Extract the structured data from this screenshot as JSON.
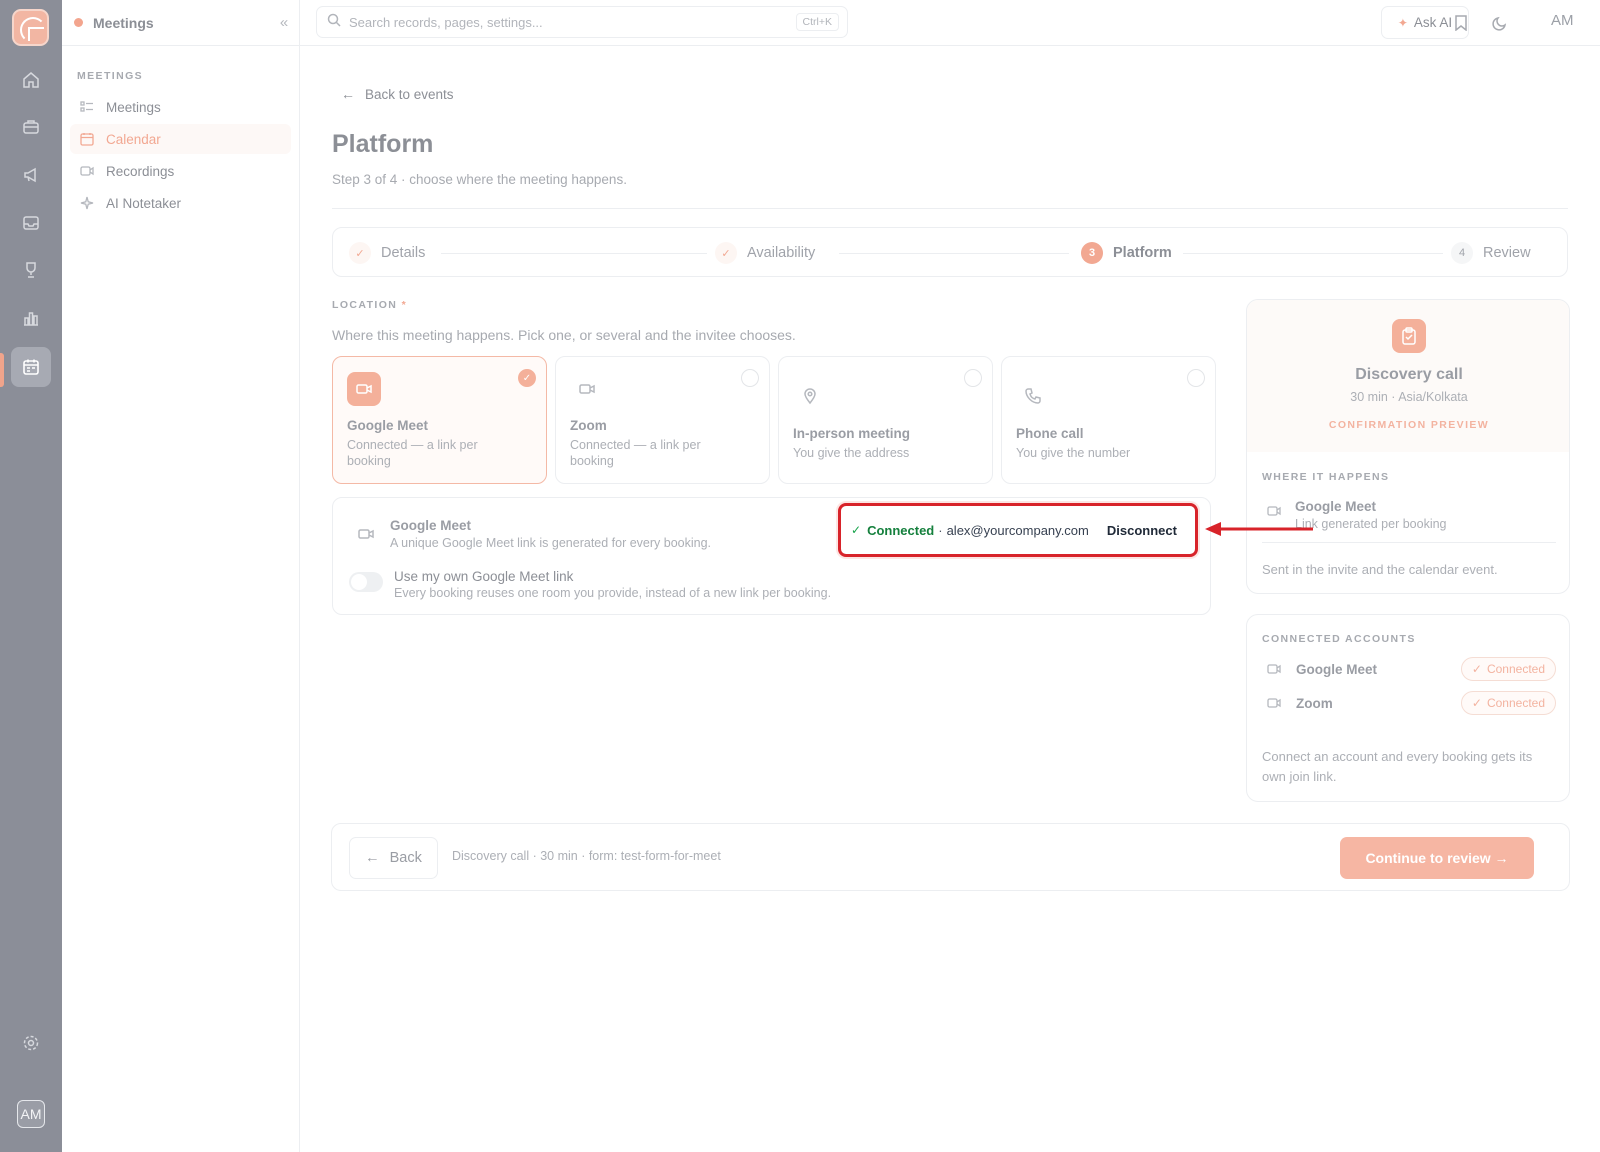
{
  "app": {
    "section_title": "Meetings",
    "collapse_glyph": "«"
  },
  "rail": {
    "icons": [
      "home-icon",
      "briefcase-icon",
      "megaphone-icon",
      "inbox-icon",
      "trophy-icon",
      "bar-chart-icon",
      "calendar-icon"
    ],
    "avatar_initials": "AM"
  },
  "sidebar": {
    "section_label": "MEETINGS",
    "items": [
      {
        "label": "Meetings",
        "icon": "list-icon"
      },
      {
        "label": "Calendar",
        "icon": "calendar-icon",
        "active": true
      },
      {
        "label": "Recordings",
        "icon": "video-icon"
      },
      {
        "label": "AI Notetaker",
        "icon": "sparkle-icon"
      }
    ]
  },
  "topbar": {
    "search_placeholder": "Search records, pages, settings...",
    "search_shortcut": "Ctrl+K",
    "ask_ai_label": "Ask AI",
    "initials": "AM"
  },
  "page": {
    "back_label": "Back to events",
    "title": "Platform",
    "subtitle": "Step 3 of 4 · choose where the meeting happens."
  },
  "stepper": [
    {
      "label": "Details",
      "status": "done",
      "badge": "✓"
    },
    {
      "label": "Availability",
      "status": "done",
      "badge": "✓"
    },
    {
      "label": "Platform",
      "status": "current",
      "badge": "3"
    },
    {
      "label": "Review",
      "status": "todo",
      "badge": "4"
    }
  ],
  "location": {
    "label": "LOCATION",
    "required_mark": "*",
    "help": "Where this meeting happens. Pick one, or several and the invitee chooses.",
    "options": [
      {
        "name": "Google Meet",
        "desc": "Connected — a link per booking",
        "icon": "video-icon",
        "selected": true
      },
      {
        "name": "Zoom",
        "desc": "Connected — a link per booking",
        "icon": "video-icon",
        "selected": false
      },
      {
        "name": "In-person meeting",
        "desc": "You give the address",
        "icon": "map-pin-icon",
        "selected": false
      },
      {
        "name": "Phone call",
        "desc": "You give the number",
        "icon": "phone-icon",
        "selected": false
      }
    ]
  },
  "detail": {
    "name": "Google Meet",
    "desc": "A unique Google Meet link is generated for every booking.",
    "toggle_label": "Use my own Google Meet link",
    "toggle_desc": "Every booking reuses one room you provide, instead of a new link per booking.",
    "toggle_on": false,
    "connection": {
      "status": "Connected",
      "separator": "·",
      "email": "alex@yourcompany.com",
      "disconnect_label": "Disconnect"
    }
  },
  "summary": {
    "title": "Discovery call",
    "meta": "30 min · Asia/Kolkata",
    "preview_label": "CONFIRMATION PREVIEW",
    "where_label": "WHERE IT HAPPENS",
    "where_name": "Google Meet",
    "where_desc": "Link generated per booking",
    "note": "Sent in the invite and the calendar event."
  },
  "accounts": {
    "label": "CONNECTED ACCOUNTS",
    "items": [
      {
        "name": "Google Meet",
        "status": "Connected"
      },
      {
        "name": "Zoom",
        "status": "Connected"
      }
    ],
    "note": "Connect an account and every booking gets its own join link."
  },
  "footer": {
    "back_label": "Back",
    "summary": "Discovery call · 30 min · form: test-form-for-meet",
    "continue_label": "Continue to review →"
  },
  "colors": {
    "accent": "#f2a892",
    "rail": "#8b8e98",
    "highlight_border": "#d8232a",
    "connected_green": "#15803d"
  }
}
